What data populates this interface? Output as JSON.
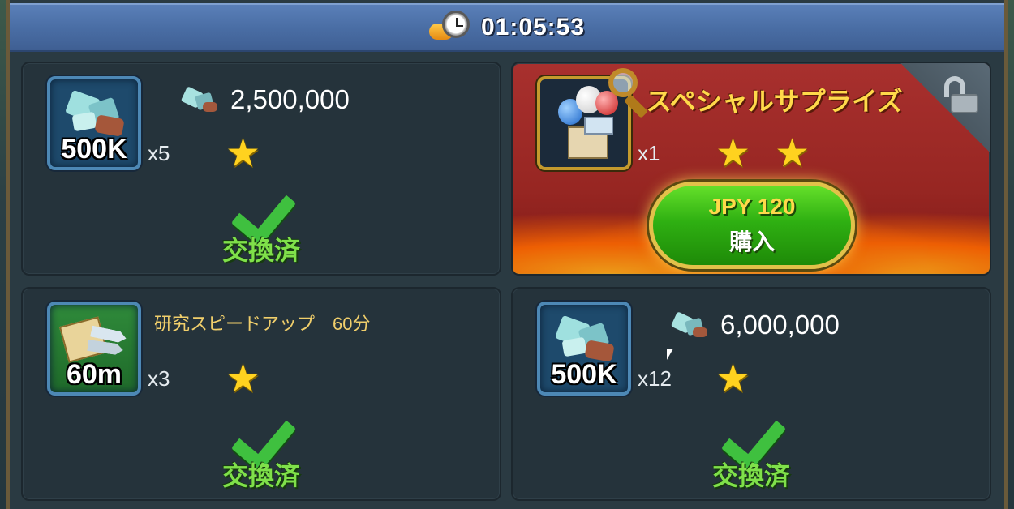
{
  "timer": {
    "value": "01:05:53",
    "icon": "clock-arrow-icon"
  },
  "cards": [
    {
      "item_label": "500K",
      "quantity": "x5",
      "resource_value": "2,500,000",
      "status": "交換済",
      "stars": 1
    },
    {
      "title": "スペシャルサプライズ",
      "quantity": "x1",
      "stars": 2,
      "price": "JPY 120",
      "buy_label": "購入",
      "lock_state": "unlocked"
    },
    {
      "title": "研究スピードアップ　60分",
      "item_label": "60m",
      "quantity": "x3",
      "status": "交換済",
      "stars": 1
    },
    {
      "item_label": "500K",
      "quantity": "x12",
      "resource_value": "6,000,000",
      "status": "交換済",
      "stars": 1
    }
  ],
  "colors": {
    "timer_bar": "#4a6ea5",
    "card_bg": "#25333b",
    "special_bg": "#a8302e",
    "check_green": "#3fc03f",
    "star_gold": "#ffd21f",
    "buy_button": "#2fb012"
  }
}
